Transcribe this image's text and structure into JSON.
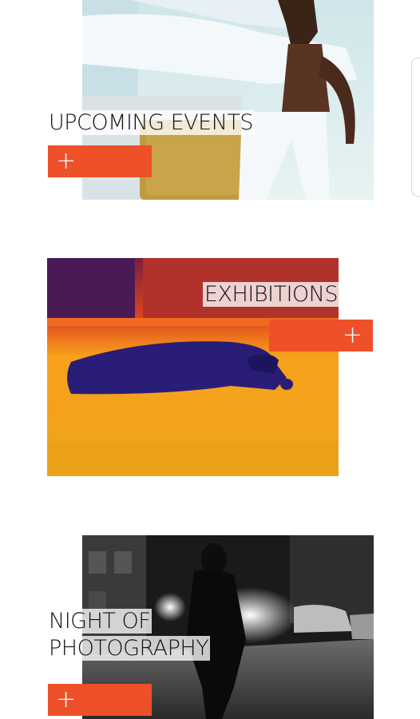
{
  "sections": [
    {
      "title_lines": [
        "UPCOMING EVENTS"
      ],
      "button_label": "+",
      "image": "dancer-photo"
    },
    {
      "title_lines": [
        "EXHIBITIONS"
      ],
      "button_label": "+",
      "image": "thermal-figure-photo"
    },
    {
      "title_lines": [
        "NIGHT OF",
        "PHOTOGRAPHY"
      ],
      "button_label": "+",
      "image": "night-street-photo"
    }
  ],
  "colors": {
    "accent": "#ee5029",
    "background": "#ffffff"
  }
}
